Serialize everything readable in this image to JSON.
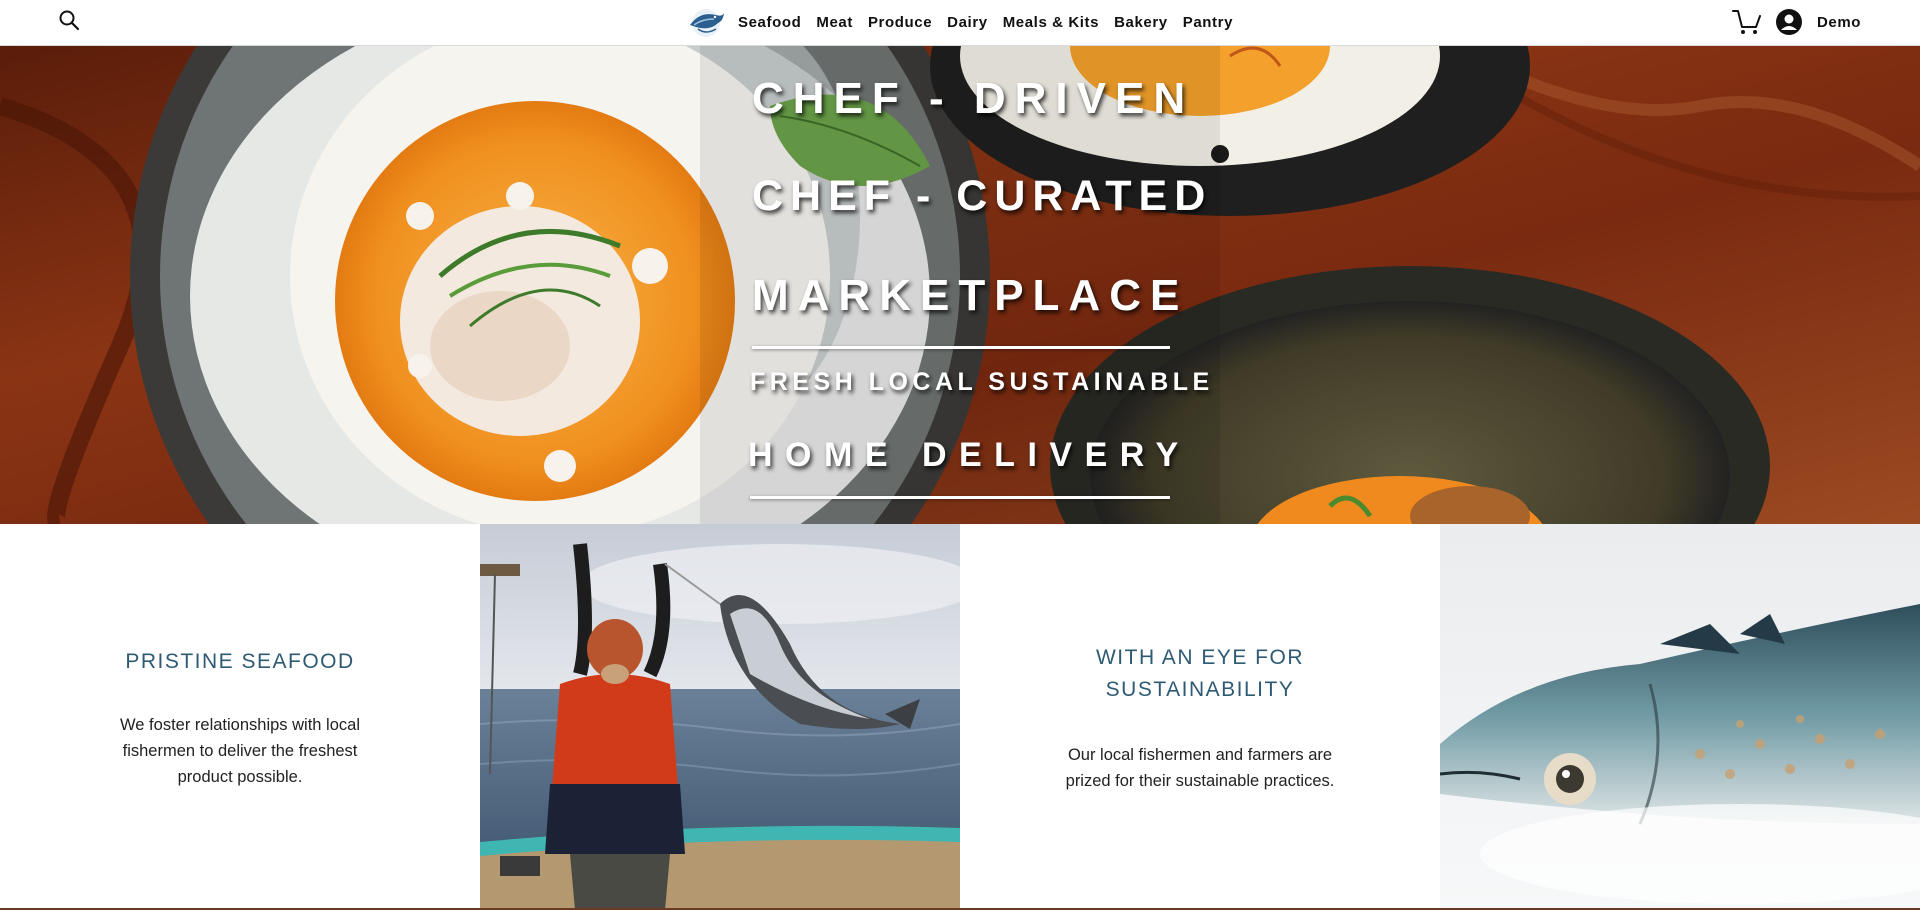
{
  "header": {
    "search_icon": "search-icon",
    "logo_icon": "fish-logo-icon",
    "nav": [
      "Seafood",
      "Meat",
      "Produce",
      "Dairy",
      "Meals & Kits",
      "Bakery",
      "Pantry"
    ],
    "cart_icon": "cart-icon",
    "account_icon": "user-avatar-icon",
    "account_name": "Demo"
  },
  "hero": {
    "lines": [
      "CHEF - DRIVEN",
      "CHEF - CURATED",
      "MARKETPLACE",
      "FRESH LOCAL SUSTAINABLE",
      "HOME DELIVERY"
    ]
  },
  "features": [
    {
      "title": "PRISTINE SEAFOOD",
      "text": "We foster relationships with local fishermen to deliver the freshest product possible."
    },
    {
      "title_line1": "WITH AN EYE FOR",
      "title_line2": "SUSTAINABILITY",
      "text": "Our local fishermen and farmers are prized for their sustainable practices."
    }
  ],
  "colors": {
    "feature_title": "#2e5a73",
    "hero_wood": "#7a2d12",
    "sauce_orange": "#f29a2e"
  }
}
